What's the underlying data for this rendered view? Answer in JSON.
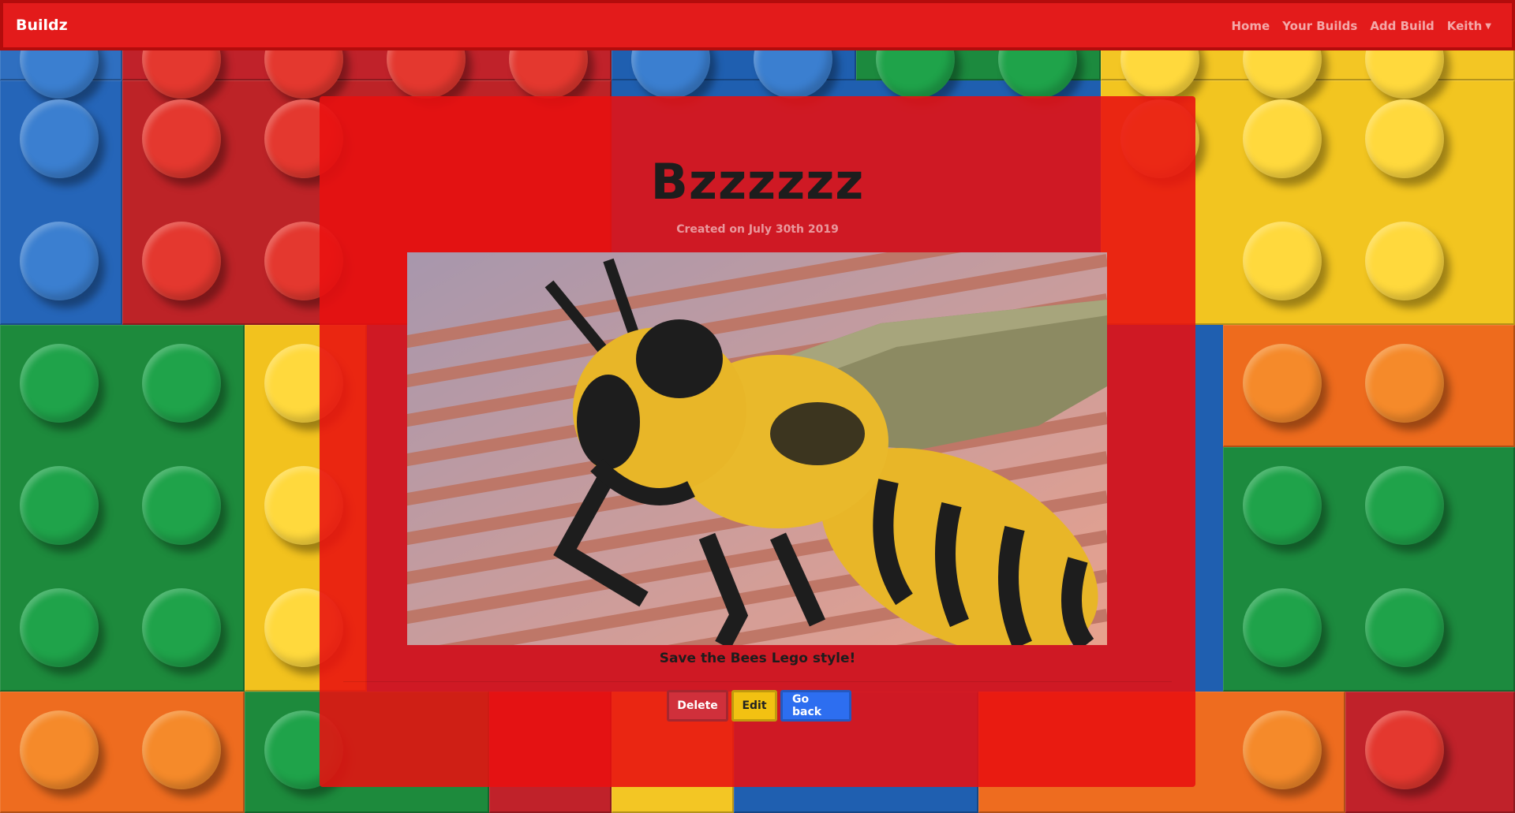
{
  "navbar": {
    "brand": "Buildz",
    "links": [
      "Home",
      "Your Builds",
      "Add Build",
      "Keith"
    ]
  },
  "build": {
    "title": "Bzzzzzz",
    "created": "Created on July 30th 2019",
    "image_alt": "Lego bee sculpture",
    "description": "Save the Bees Lego style!"
  },
  "actions": {
    "delete": "Delete",
    "edit": "Edit",
    "back": "Go back"
  },
  "colors": {
    "navbar": "#e31b1b",
    "card": "#e81010",
    "delete": "#d0303b",
    "edit": "#f2c112",
    "back": "#2d6ef0"
  }
}
